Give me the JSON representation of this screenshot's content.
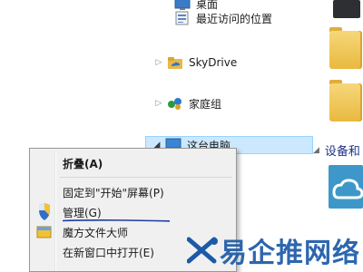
{
  "nav": {
    "items": [
      {
        "label": "桌面",
        "icon": "desktop-folder-icon"
      },
      {
        "label": "最近访问的位置",
        "icon": "recent-places-icon"
      },
      {
        "label": "SkyDrive",
        "icon": "skydrive-icon"
      },
      {
        "label": "家庭组",
        "icon": "homegroup-icon"
      },
      {
        "label": "这台电脑",
        "icon": "this-pc-icon"
      }
    ]
  },
  "right_pane": {
    "section_title": "设备和"
  },
  "context_menu": {
    "items": [
      {
        "label": "折叠(A)",
        "icon": ""
      },
      {
        "label": "固定到\"开始\"屏幕(P)",
        "icon": ""
      },
      {
        "label": "管理(G)",
        "icon": "uac-shield-icon"
      },
      {
        "label": "魔方文件大师",
        "icon": "magic-cube-icon"
      },
      {
        "label": "在新窗口中打开(E)",
        "icon": ""
      }
    ]
  },
  "annotation": {
    "color": "#1f3c9c"
  },
  "watermark": {
    "text": "易企推网络",
    "color": "#1c5aa8"
  },
  "colors": {
    "selection_bg": "#cce8ff",
    "menu_bg": "#f0f0f0",
    "folder": "#e9b93f"
  }
}
